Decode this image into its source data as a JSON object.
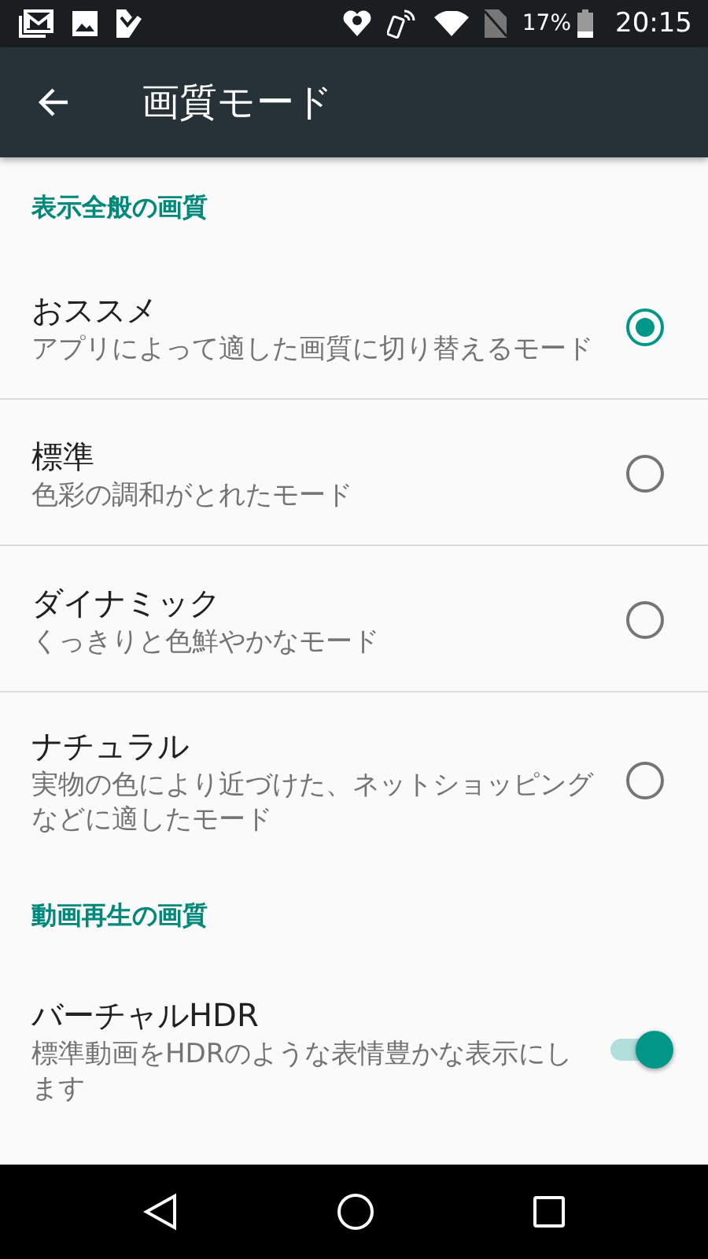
{
  "status_bar": {
    "battery": "17%",
    "time": "20:15"
  },
  "app_bar": {
    "title": "画質モード"
  },
  "sections": [
    {
      "header": "表示全般の画質",
      "items": [
        {
          "kind": "radio",
          "title": "おススメ",
          "summary": "アプリによって適した画質に切り替えるモード",
          "selected": true
        },
        {
          "kind": "radio",
          "title": "標準",
          "summary": "色彩の調和がとれたモード",
          "selected": false
        },
        {
          "kind": "radio",
          "title": "ダイナミック",
          "summary": "くっきりと色鮮やかなモード",
          "selected": false
        },
        {
          "kind": "radio",
          "title": "ナチュラル",
          "summary": "実物の色により近づけた、ネットショッピングなどに適したモード",
          "selected": false
        }
      ]
    },
    {
      "header": "動画再生の画質",
      "items": [
        {
          "kind": "switch",
          "title": "バーチャルHDR",
          "summary": "標準動画をHDRのような表情豊かな表示にします",
          "on": true
        }
      ]
    }
  ]
}
